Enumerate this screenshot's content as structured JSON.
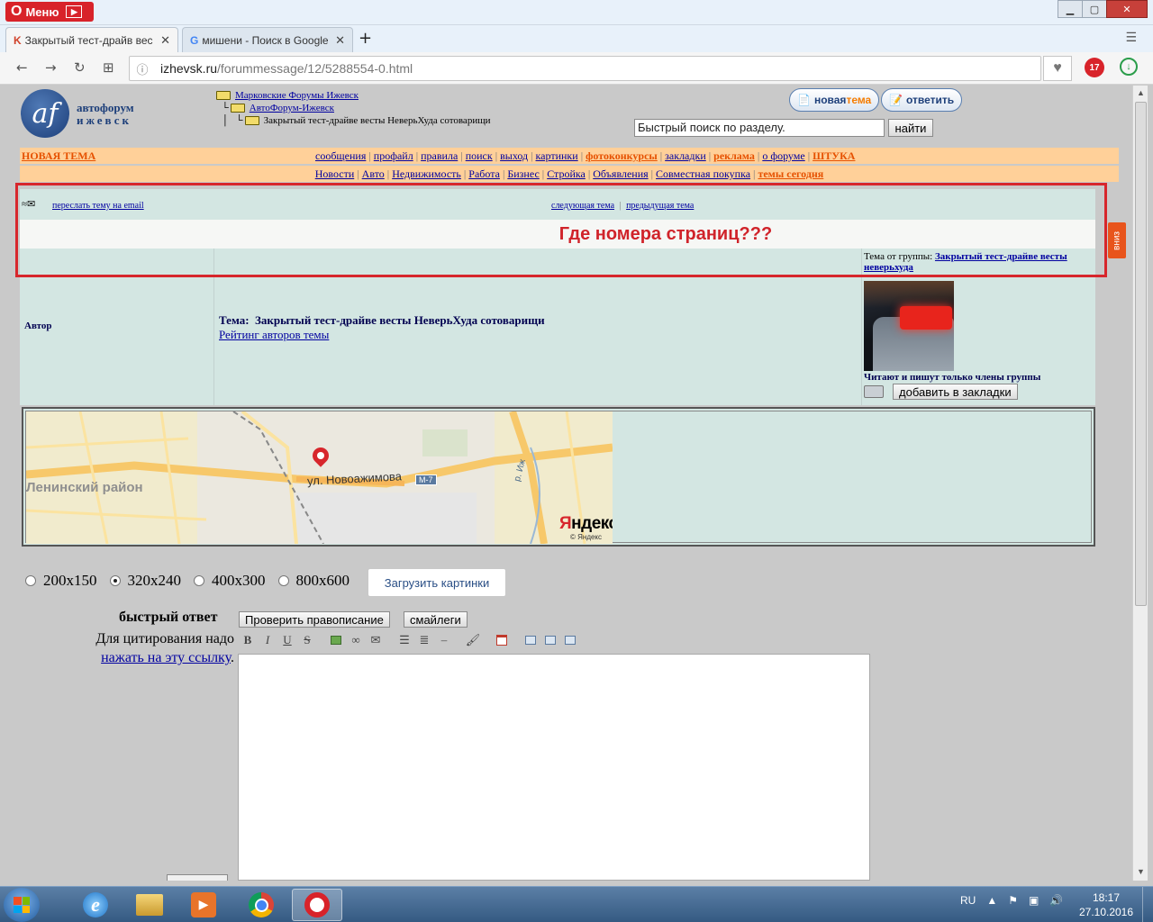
{
  "browser": {
    "menu_label": "Меню",
    "tabs": [
      {
        "title": "Закрытый тест-драйв вес",
        "favicon": "izhevsk-favicon",
        "active": true
      },
      {
        "title": "мишени - Поиск в Google",
        "favicon": "google-favicon",
        "active": false
      }
    ],
    "url_host": "izhevsk.ru",
    "url_path": "/forummessage/12/5288554-0.html",
    "extension_badge": "17"
  },
  "site": {
    "logo_mark": "af",
    "logo_line1": "автофорум",
    "logo_line2": "ижевск",
    "breadcrumb": [
      "Марковские Форумы Ижевск",
      "АвтоФорум-Ижевск",
      "Закрытый тест-драйве весты НеверьХуда сотоварищи"
    ],
    "btn_new_topic_a": "новая ",
    "btn_new_topic_b": "тема",
    "btn_reply": "ответить",
    "search_placeholder": "Быстрый поиск по разделу.",
    "search_button": "найти",
    "new_topic_link": "НОВАЯ ТЕМА",
    "menu1": [
      {
        "label": "сообщения",
        "hl": false
      },
      {
        "label": "профайл",
        "hl": false
      },
      {
        "label": "правила",
        "hl": false
      },
      {
        "label": "поиск",
        "hl": false
      },
      {
        "label": "выход",
        "hl": false
      },
      {
        "label": "картинки",
        "hl": false
      },
      {
        "label": "фотоконкурсы",
        "hl": true
      },
      {
        "label": "закладки",
        "hl": false
      },
      {
        "label": "реклама",
        "hl": true
      },
      {
        "label": "о форуме",
        "hl": false
      },
      {
        "label": "ШТУКА",
        "hl": true
      }
    ],
    "menu2": [
      {
        "label": "Новости",
        "hl": false
      },
      {
        "label": "Авто",
        "hl": false
      },
      {
        "label": "Недвижимость",
        "hl": false
      },
      {
        "label": "Работа",
        "hl": false
      },
      {
        "label": "Бизнес",
        "hl": false
      },
      {
        "label": "Стройка",
        "hl": false
      },
      {
        "label": "Объявления",
        "hl": false
      },
      {
        "label": "Совместная покупка",
        "hl": false
      },
      {
        "label": "темы сегодня",
        "hl": true
      }
    ],
    "forward_email": "переслать тему на email",
    "next_topic": "следующая тема",
    "prev_topic": "предыдущая тема",
    "annotation": "Где номера страниц???",
    "down_tab": "вниз"
  },
  "topic": {
    "author_label": "Автор",
    "topic_label": "Тема:",
    "topic_title": "Закрытый тест-драйве весты НеверьХуда сотоварищи",
    "rating_link": "Рейтинг авторов темы",
    "group_prefix": "Тема от группы:",
    "group_name": "Закрытый тест-драйве весты неверьхуда",
    "readers_note": "Читают и пишут только члены группы",
    "bookmark_button": "добавить в закладки"
  },
  "map": {
    "district": "Ленинский район",
    "street": "ул. Новоажимова",
    "route_badge": "М-7",
    "river": "р. Иж",
    "brand_first": "Я",
    "brand_rest": "ндекс",
    "copyright": "© Яндекс"
  },
  "upload": {
    "sizes": [
      {
        "label": "200x150",
        "selected": false
      },
      {
        "label": "320x240",
        "selected": true
      },
      {
        "label": "400x300",
        "selected": false
      },
      {
        "label": "800x600",
        "selected": false
      }
    ],
    "button": "Загрузить картинки"
  },
  "reply": {
    "label": "быстрый ответ",
    "spellcheck_button": "Проверить правописание",
    "smileys_button": "смайлеги",
    "quote_hint": "Для цитирования надо",
    "quote_link": "нажать на эту ссылку",
    "quote_end": ".",
    "textarea_value": ""
  },
  "taskbar": {
    "lang": "RU",
    "time": "18:17",
    "date": "27.10.2016"
  }
}
